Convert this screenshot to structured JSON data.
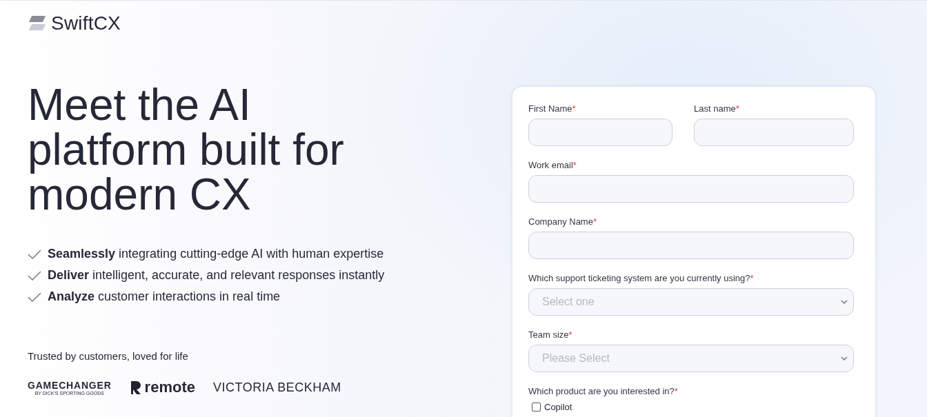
{
  "brand": {
    "name": "SwiftCX"
  },
  "hero": {
    "headline": [
      "Meet the AI",
      "platform built for",
      "modern CX"
    ],
    "bullets": [
      "**Seamlessly** integrating cutting-edge AI with human expertise",
      "**Deliver** intelligent, accurate, and relevant responses instantly",
      "**Analyze** customer interactions in real time"
    ]
  },
  "trust": {
    "caption": "Trusted by customers, loved for life",
    "logos": [
      {
        "kind": "stacked",
        "name": "GAMECHANGER",
        "tagline": "BY DICK'S SPORTING GOODS"
      },
      {
        "kind": "mark",
        "name": "remote"
      },
      {
        "kind": "wordmark",
        "name": "VICTORIA BECKHAM"
      }
    ]
  },
  "form": {
    "rows": [
      {
        "fields": [
          {
            "kind": "text",
            "label": "First Name",
            "mark": "*"
          },
          {
            "kind": "text",
            "label": "Last name",
            "mark": "*"
          }
        ]
      },
      {
        "fields": [
          {
            "kind": "text",
            "label": "Work email",
            "mark": "*"
          }
        ]
      },
      {
        "fields": [
          {
            "kind": "text",
            "label": "Company Name",
            "mark": "*"
          }
        ]
      },
      {
        "fields": [
          {
            "kind": "select",
            "label": "Which support ticketing system are you currently using?",
            "mark": "*",
            "placeholder": "Select one"
          }
        ]
      },
      {
        "fields": [
          {
            "kind": "select",
            "label": "Team size",
            "mark": "*",
            "placeholder": "Please Select"
          }
        ]
      },
      {
        "fields": [
          {
            "kind": "checks",
            "label": "Which product are you interested in?",
            "mark": "*",
            "options": [
              {
                "label": "Copilot",
                "checked": false
              }
            ]
          }
        ]
      }
    ]
  }
}
